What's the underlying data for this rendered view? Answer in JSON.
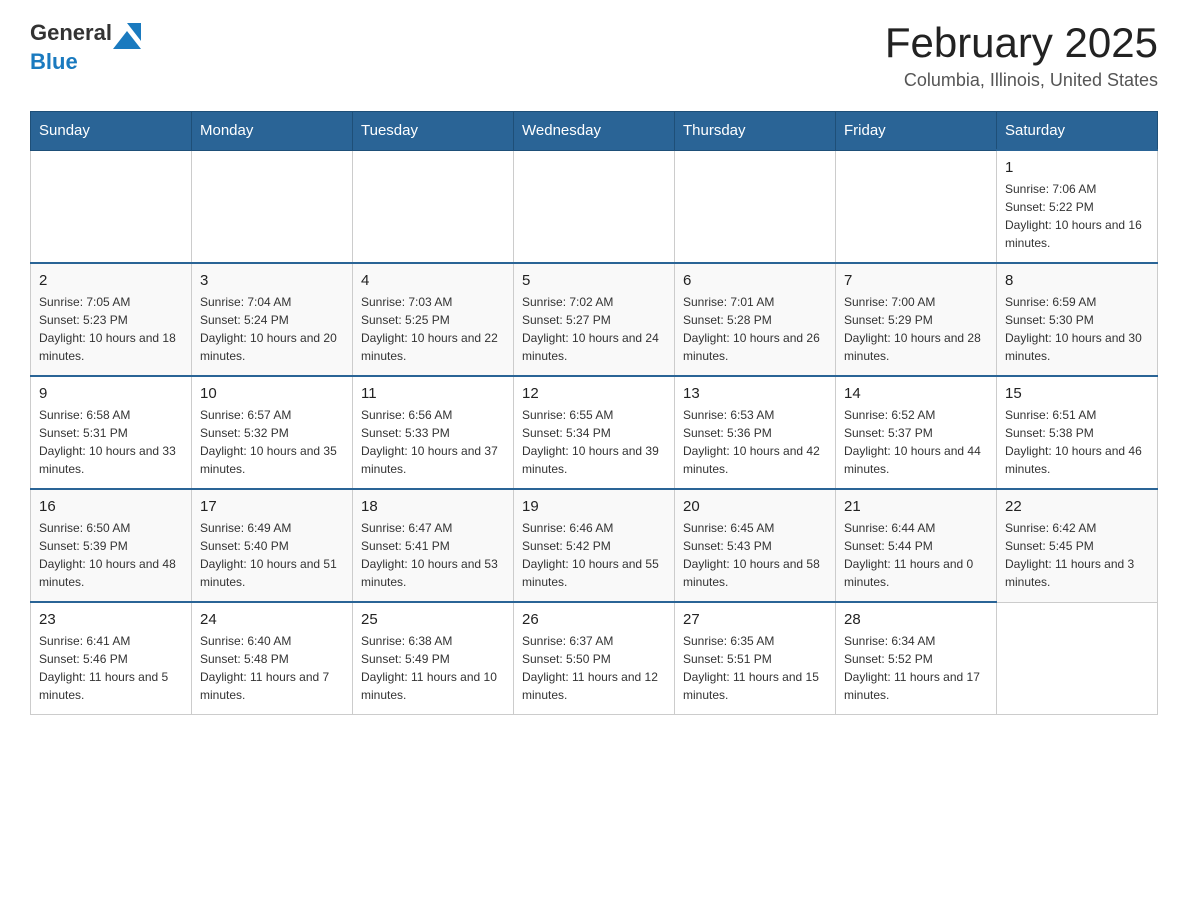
{
  "header": {
    "logo": {
      "text_general": "General",
      "text_blue": "Blue",
      "arrow_color": "#1a7abf"
    },
    "title": "February 2025",
    "subtitle": "Columbia, Illinois, United States"
  },
  "calendar": {
    "weekdays": [
      "Sunday",
      "Monday",
      "Tuesday",
      "Wednesday",
      "Thursday",
      "Friday",
      "Saturday"
    ],
    "weeks": [
      [
        {
          "day": "",
          "sunrise": "",
          "sunset": "",
          "daylight": ""
        },
        {
          "day": "",
          "sunrise": "",
          "sunset": "",
          "daylight": ""
        },
        {
          "day": "",
          "sunrise": "",
          "sunset": "",
          "daylight": ""
        },
        {
          "day": "",
          "sunrise": "",
          "sunset": "",
          "daylight": ""
        },
        {
          "day": "",
          "sunrise": "",
          "sunset": "",
          "daylight": ""
        },
        {
          "day": "",
          "sunrise": "",
          "sunset": "",
          "daylight": ""
        },
        {
          "day": "1",
          "sunrise": "Sunrise: 7:06 AM",
          "sunset": "Sunset: 5:22 PM",
          "daylight": "Daylight: 10 hours and 16 minutes."
        }
      ],
      [
        {
          "day": "2",
          "sunrise": "Sunrise: 7:05 AM",
          "sunset": "Sunset: 5:23 PM",
          "daylight": "Daylight: 10 hours and 18 minutes."
        },
        {
          "day": "3",
          "sunrise": "Sunrise: 7:04 AM",
          "sunset": "Sunset: 5:24 PM",
          "daylight": "Daylight: 10 hours and 20 minutes."
        },
        {
          "day": "4",
          "sunrise": "Sunrise: 7:03 AM",
          "sunset": "Sunset: 5:25 PM",
          "daylight": "Daylight: 10 hours and 22 minutes."
        },
        {
          "day": "5",
          "sunrise": "Sunrise: 7:02 AM",
          "sunset": "Sunset: 5:27 PM",
          "daylight": "Daylight: 10 hours and 24 minutes."
        },
        {
          "day": "6",
          "sunrise": "Sunrise: 7:01 AM",
          "sunset": "Sunset: 5:28 PM",
          "daylight": "Daylight: 10 hours and 26 minutes."
        },
        {
          "day": "7",
          "sunrise": "Sunrise: 7:00 AM",
          "sunset": "Sunset: 5:29 PM",
          "daylight": "Daylight: 10 hours and 28 minutes."
        },
        {
          "day": "8",
          "sunrise": "Sunrise: 6:59 AM",
          "sunset": "Sunset: 5:30 PM",
          "daylight": "Daylight: 10 hours and 30 minutes."
        }
      ],
      [
        {
          "day": "9",
          "sunrise": "Sunrise: 6:58 AM",
          "sunset": "Sunset: 5:31 PM",
          "daylight": "Daylight: 10 hours and 33 minutes."
        },
        {
          "day": "10",
          "sunrise": "Sunrise: 6:57 AM",
          "sunset": "Sunset: 5:32 PM",
          "daylight": "Daylight: 10 hours and 35 minutes."
        },
        {
          "day": "11",
          "sunrise": "Sunrise: 6:56 AM",
          "sunset": "Sunset: 5:33 PM",
          "daylight": "Daylight: 10 hours and 37 minutes."
        },
        {
          "day": "12",
          "sunrise": "Sunrise: 6:55 AM",
          "sunset": "Sunset: 5:34 PM",
          "daylight": "Daylight: 10 hours and 39 minutes."
        },
        {
          "day": "13",
          "sunrise": "Sunrise: 6:53 AM",
          "sunset": "Sunset: 5:36 PM",
          "daylight": "Daylight: 10 hours and 42 minutes."
        },
        {
          "day": "14",
          "sunrise": "Sunrise: 6:52 AM",
          "sunset": "Sunset: 5:37 PM",
          "daylight": "Daylight: 10 hours and 44 minutes."
        },
        {
          "day": "15",
          "sunrise": "Sunrise: 6:51 AM",
          "sunset": "Sunset: 5:38 PM",
          "daylight": "Daylight: 10 hours and 46 minutes."
        }
      ],
      [
        {
          "day": "16",
          "sunrise": "Sunrise: 6:50 AM",
          "sunset": "Sunset: 5:39 PM",
          "daylight": "Daylight: 10 hours and 48 minutes."
        },
        {
          "day": "17",
          "sunrise": "Sunrise: 6:49 AM",
          "sunset": "Sunset: 5:40 PM",
          "daylight": "Daylight: 10 hours and 51 minutes."
        },
        {
          "day": "18",
          "sunrise": "Sunrise: 6:47 AM",
          "sunset": "Sunset: 5:41 PM",
          "daylight": "Daylight: 10 hours and 53 minutes."
        },
        {
          "day": "19",
          "sunrise": "Sunrise: 6:46 AM",
          "sunset": "Sunset: 5:42 PM",
          "daylight": "Daylight: 10 hours and 55 minutes."
        },
        {
          "day": "20",
          "sunrise": "Sunrise: 6:45 AM",
          "sunset": "Sunset: 5:43 PM",
          "daylight": "Daylight: 10 hours and 58 minutes."
        },
        {
          "day": "21",
          "sunrise": "Sunrise: 6:44 AM",
          "sunset": "Sunset: 5:44 PM",
          "daylight": "Daylight: 11 hours and 0 minutes."
        },
        {
          "day": "22",
          "sunrise": "Sunrise: 6:42 AM",
          "sunset": "Sunset: 5:45 PM",
          "daylight": "Daylight: 11 hours and 3 minutes."
        }
      ],
      [
        {
          "day": "23",
          "sunrise": "Sunrise: 6:41 AM",
          "sunset": "Sunset: 5:46 PM",
          "daylight": "Daylight: 11 hours and 5 minutes."
        },
        {
          "day": "24",
          "sunrise": "Sunrise: 6:40 AM",
          "sunset": "Sunset: 5:48 PM",
          "daylight": "Daylight: 11 hours and 7 minutes."
        },
        {
          "day": "25",
          "sunrise": "Sunrise: 6:38 AM",
          "sunset": "Sunset: 5:49 PM",
          "daylight": "Daylight: 11 hours and 10 minutes."
        },
        {
          "day": "26",
          "sunrise": "Sunrise: 6:37 AM",
          "sunset": "Sunset: 5:50 PM",
          "daylight": "Daylight: 11 hours and 12 minutes."
        },
        {
          "day": "27",
          "sunrise": "Sunrise: 6:35 AM",
          "sunset": "Sunset: 5:51 PM",
          "daylight": "Daylight: 11 hours and 15 minutes."
        },
        {
          "day": "28",
          "sunrise": "Sunrise: 6:34 AM",
          "sunset": "Sunset: 5:52 PM",
          "daylight": "Daylight: 11 hours and 17 minutes."
        },
        {
          "day": "",
          "sunrise": "",
          "sunset": "",
          "daylight": ""
        }
      ]
    ]
  }
}
